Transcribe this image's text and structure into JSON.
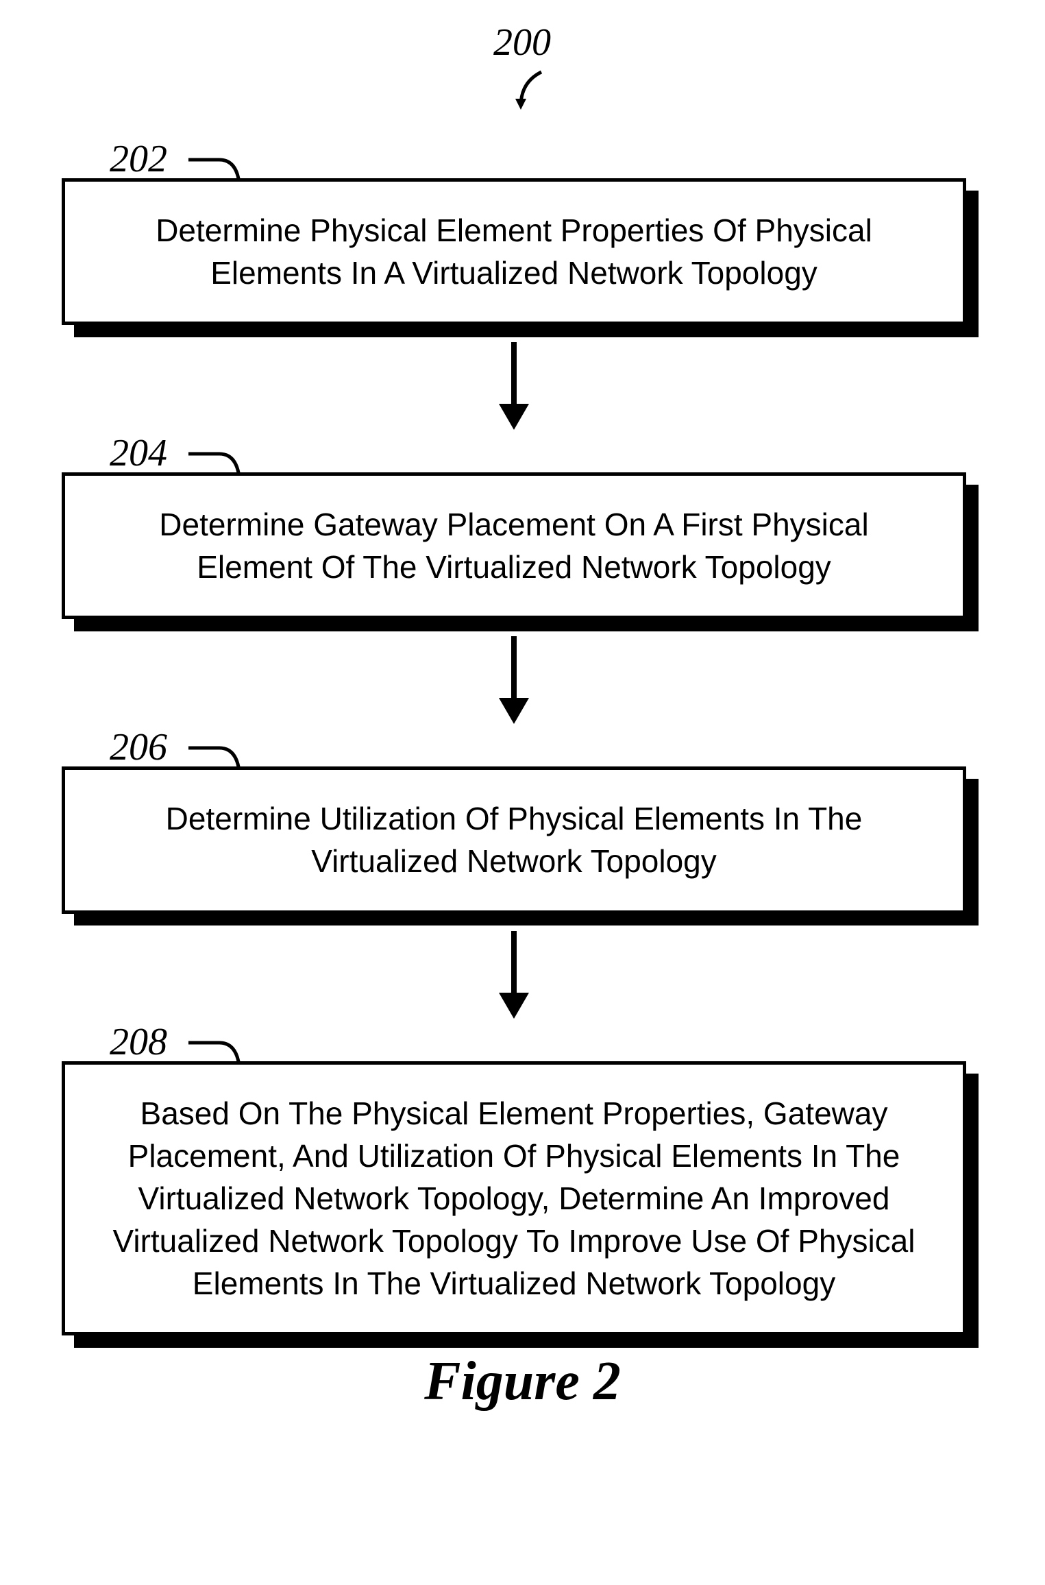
{
  "diagram_ref": "200",
  "figure_caption": "Figure 2",
  "steps": [
    {
      "ref": "202",
      "text": "Determine Physical Element Properties Of Physical Elements In A Virtualized Network Topology"
    },
    {
      "ref": "204",
      "text": "Determine Gateway Placement On A First Physical Element Of The Virtualized Network Topology"
    },
    {
      "ref": "206",
      "text": "Determine Utilization Of Physical Elements In The Virtualized Network Topology"
    },
    {
      "ref": "208",
      "text": "Based On The Physical Element Properties, Gateway Placement, And Utilization Of Physical Elements In The Virtualized Network Topology, Determine An Improved Virtualized Network Topology To Improve Use Of Physical Elements In The Virtualized Network Topology"
    }
  ]
}
